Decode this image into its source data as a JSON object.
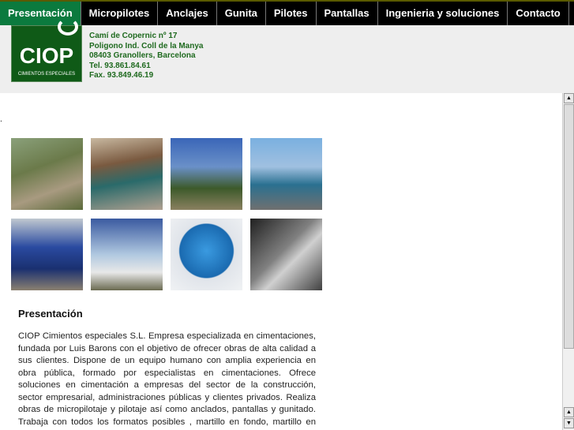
{
  "nav": {
    "items": [
      {
        "label": "Presentación",
        "active": true
      },
      {
        "label": "Micropilotes"
      },
      {
        "label": "Anclajes"
      },
      {
        "label": "Gunita"
      },
      {
        "label": "Pilotes"
      },
      {
        "label": "Pantallas"
      },
      {
        "label": "Ingenieria y soluciones"
      },
      {
        "label": "Contacto"
      }
    ]
  },
  "logo": {
    "name": "CIOP",
    "tagline": "CIMIENTOS ESPECIALES"
  },
  "address": {
    "line1": "Camí de Copernic nº 17",
    "line2": "Poligono Ind. Coll de la Manya",
    "line3": "08403 Granollers, Barcelona",
    "phone": "Tel. 93.861.84.61",
    "fax": "Fax. 93.849.46.19"
  },
  "content": {
    "dot": ".",
    "title": "Presentación",
    "paragraph": "CIOP Cimientos especiales S.L. Empresa especializada en cimentaciones, fundada por Luis Barons con el objetivo de ofrecer obras de alta calidad a sus clientes. Dispone de un equipo humano con amplia experiencia en obra pública, formado por especialistas en cimentaciones. Ofrece soluciones en cimentación a empresas del sector de la construcción, sector empresarial, administraciones públicas y clientes privados. Realiza obras de micropilotaje y pilotaje así como anclados, pantallas y gunitado. Trabaja con todos los formatos posibles , martillo en fondo, martillo en cabeza, helice"
  },
  "colors": {
    "nav_active": "#0b7a3e",
    "logo_green": "#0f5a17"
  }
}
